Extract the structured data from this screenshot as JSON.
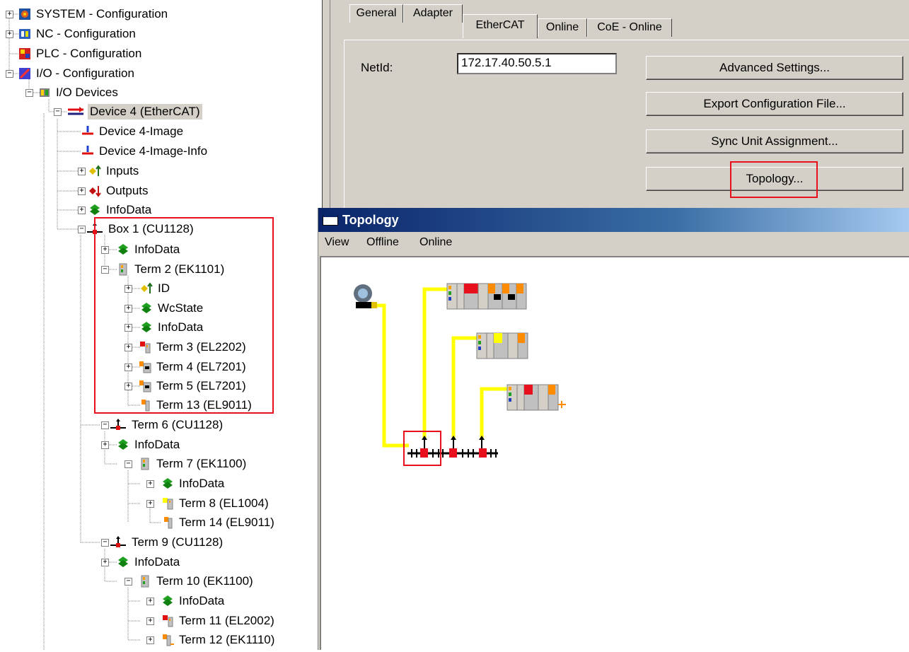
{
  "tree": {
    "items": [
      {
        "label": "SYSTEM - Configuration",
        "icon": "system-config-icon"
      },
      {
        "label": "NC - Configuration",
        "icon": "nc-config-icon"
      },
      {
        "label": "PLC - Configuration",
        "icon": "plc-config-icon"
      },
      {
        "label": "I/O - Configuration",
        "icon": "io-config-icon"
      },
      {
        "label": "I/O Devices",
        "icon": "io-devices-icon"
      },
      {
        "label": "Device 4 (EtherCAT)",
        "icon": "ethercat-device-icon"
      },
      {
        "label": "Device 4-Image",
        "icon": "image-icon"
      },
      {
        "label": "Device 4-Image-Info",
        "icon": "image-info-icon"
      },
      {
        "label": "Inputs",
        "icon": "inputs-icon"
      },
      {
        "label": "Outputs",
        "icon": "outputs-icon"
      },
      {
        "label": "InfoData",
        "icon": "infodata-icon"
      },
      {
        "label": "Box 1 (CU1128)",
        "icon": "junction-icon"
      },
      {
        "label": "InfoData",
        "icon": "infodata-icon"
      },
      {
        "label": "Term 2 (EK1101)",
        "icon": "coupler-icon"
      },
      {
        "label": "ID",
        "icon": "inputs-icon"
      },
      {
        "label": "WcState",
        "icon": "infodata-icon"
      },
      {
        "label": "InfoData",
        "icon": "infodata-icon"
      },
      {
        "label": "Term 3 (EL2202)",
        "icon": "output-terminal-icon"
      },
      {
        "label": "Term 4 (EL7201)",
        "icon": "motor-terminal-icon"
      },
      {
        "label": "Term 5 (EL7201)",
        "icon": "motor-terminal-icon"
      },
      {
        "label": "Term 13 (EL9011)",
        "icon": "end-terminal-icon"
      },
      {
        "label": "Term 6 (CU1128)",
        "icon": "junction-icon"
      },
      {
        "label": "InfoData",
        "icon": "infodata-icon"
      },
      {
        "label": "Term 7 (EK1100)",
        "icon": "coupler-icon"
      },
      {
        "label": "InfoData",
        "icon": "infodata-icon"
      },
      {
        "label": "Term 8 (EL1004)",
        "icon": "input-terminal-icon"
      },
      {
        "label": "Term 14 (EL9011)",
        "icon": "end-terminal-icon"
      },
      {
        "label": "Term 9 (CU1128)",
        "icon": "junction-icon"
      },
      {
        "label": "InfoData",
        "icon": "infodata-icon"
      },
      {
        "label": "Term 10 (EK1100)",
        "icon": "coupler-icon"
      },
      {
        "label": "InfoData",
        "icon": "infodata-icon"
      },
      {
        "label": "Term 11 (EL2002)",
        "icon": "output-terminal-icon"
      },
      {
        "label": "Term 12 (EK1110)",
        "icon": "extension-terminal-icon"
      }
    ]
  },
  "props": {
    "tabs": [
      "General",
      "Adapter",
      "EtherCAT",
      "Online",
      "CoE - Online"
    ],
    "active_tab": "EtherCAT",
    "netid_label": "NetId:",
    "netid_value": "172.17.40.50.5.1",
    "buttons": {
      "advanced": "Advanced Settings...",
      "export": "Export Configuration File...",
      "sync": "Sync Unit Assignment...",
      "topology": "Topology..."
    }
  },
  "topology": {
    "title": "Topology",
    "menu": [
      "View",
      "Offline",
      "Online"
    ]
  },
  "colors": {
    "highlight": "#e8101c",
    "cable": "#ffff00",
    "orange": "#ff8c00",
    "panel": "#d4d0c8"
  }
}
